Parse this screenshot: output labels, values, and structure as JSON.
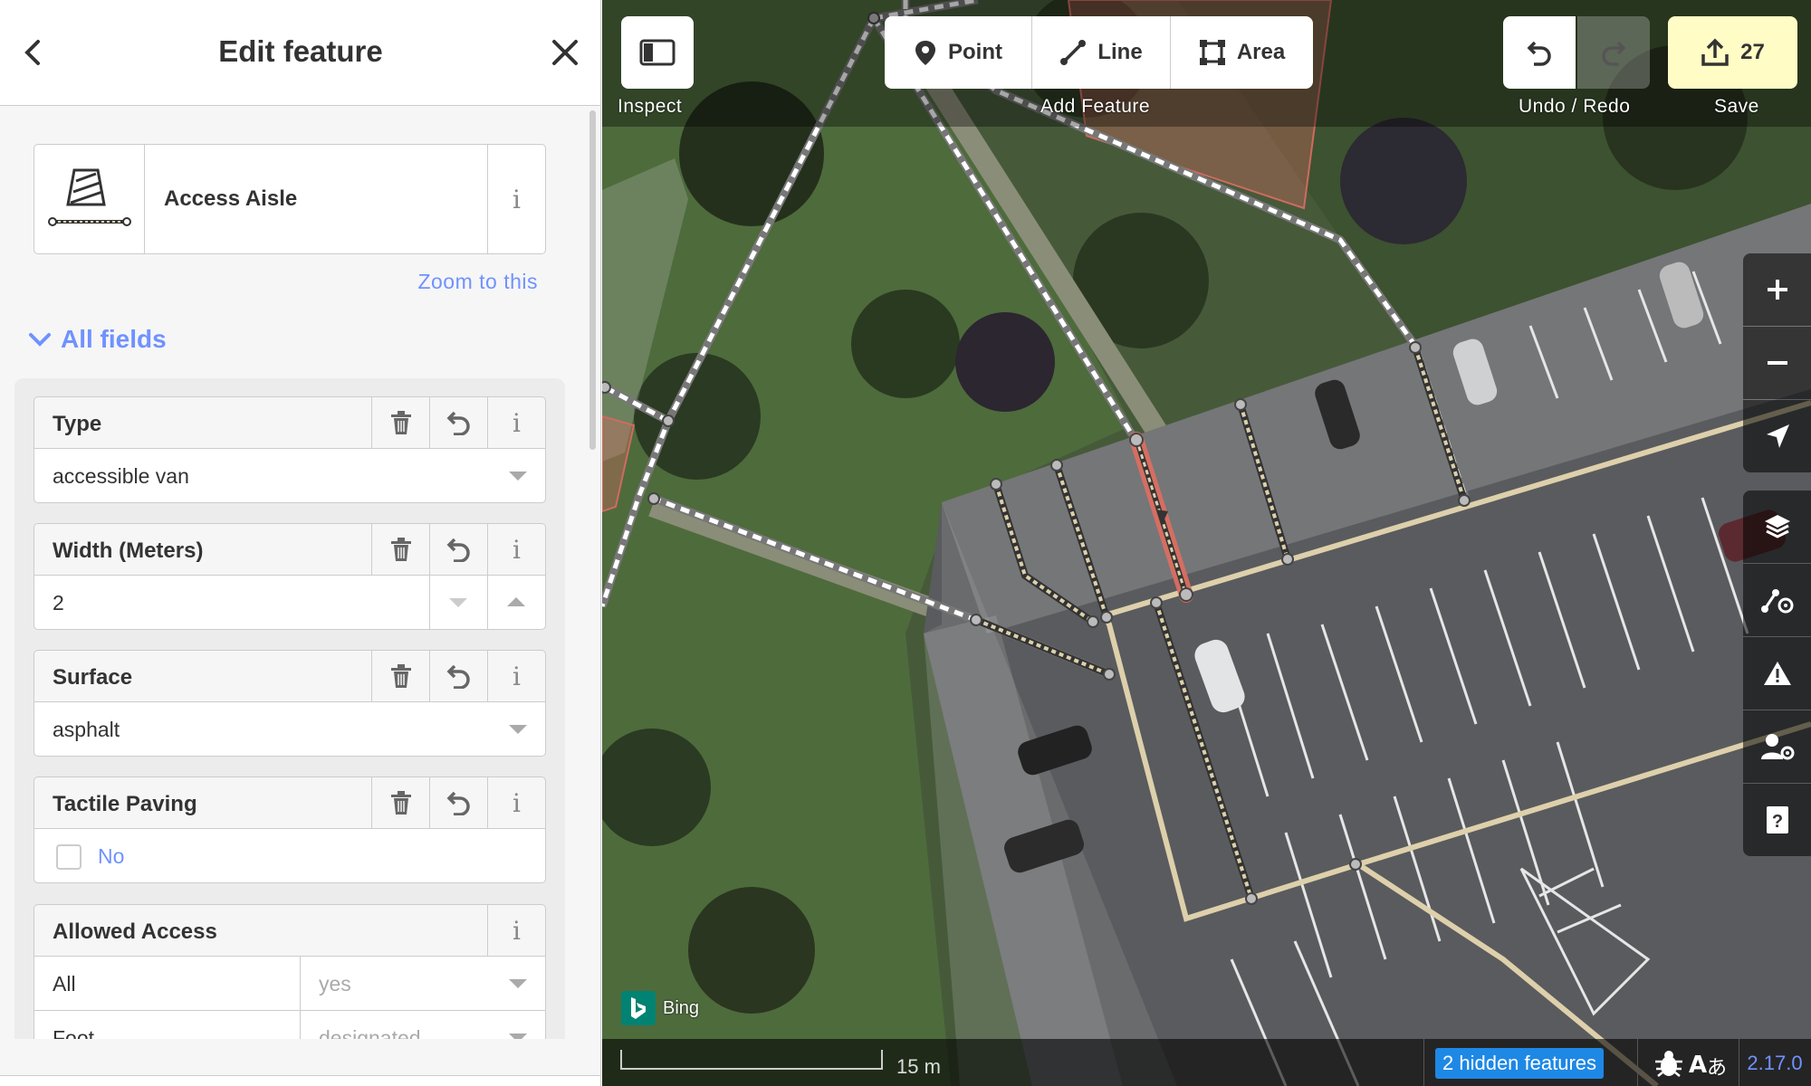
{
  "sidebar": {
    "title": "Edit feature",
    "preset": {
      "name": "Access Aisle",
      "zoom_link": "Zoom to this",
      "icon": "access-aisle-icon"
    },
    "all_fields_label": "All fields",
    "fields": {
      "type": {
        "label": "Type",
        "value": "accessible van"
      },
      "width": {
        "label": "Width (Meters)",
        "value": "2"
      },
      "surface": {
        "label": "Surface",
        "value": "asphalt"
      },
      "tactile": {
        "label": "Tactile Paving",
        "value": "No",
        "checked": false
      },
      "access": {
        "label": "Allowed Access",
        "rows": [
          {
            "key": "All",
            "placeholder": "yes"
          },
          {
            "key": "Foot",
            "placeholder": "designated"
          }
        ]
      }
    }
  },
  "map": {
    "toolbar": {
      "inspect_label": "Inspect",
      "add_feature_label": "Add Feature",
      "point": "Point",
      "line": "Line",
      "area": "Area",
      "undo_redo_label": "Undo / Redo",
      "save_label": "Save",
      "save_count": "27"
    },
    "attribution": "Bing",
    "scale": "15 m",
    "hidden_features": "2 hidden features",
    "version": "2.17.0",
    "colors": {
      "selected": "#e06e5f",
      "footway": "#ffffff",
      "service_road": "#ddd0ab",
      "save_bg": "#fffdc5",
      "link": "#7092ff"
    }
  }
}
